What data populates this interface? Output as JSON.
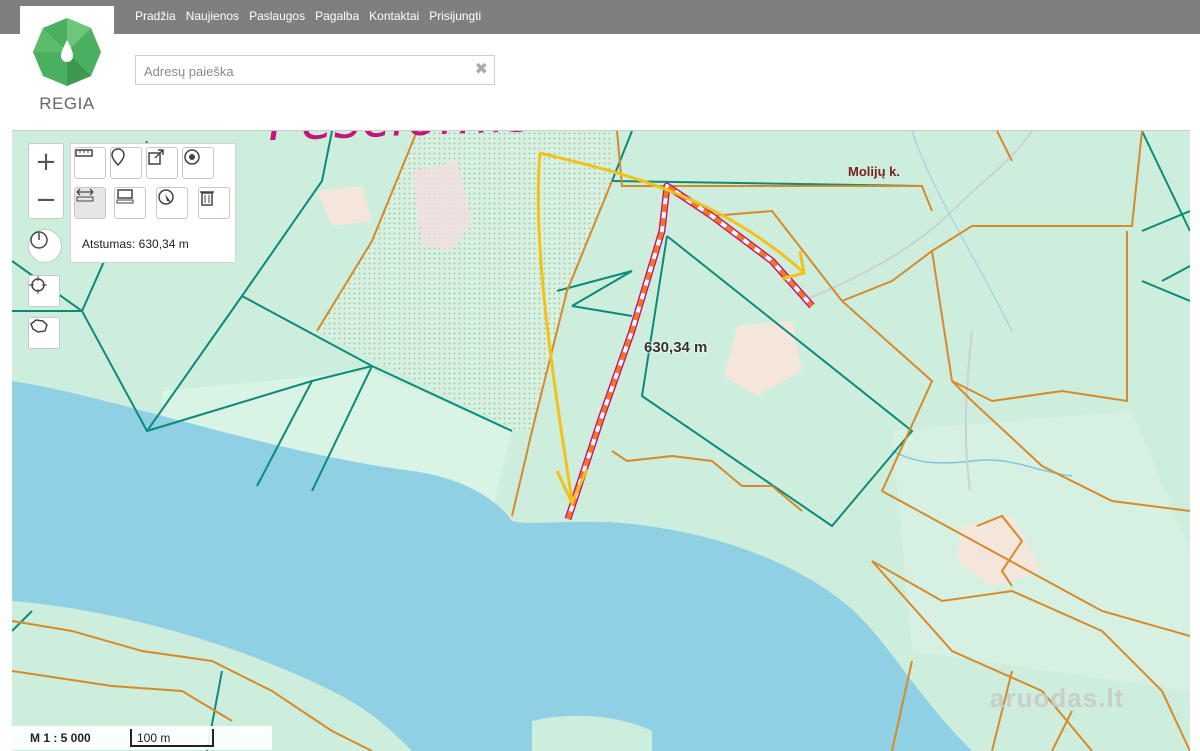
{
  "nav": {
    "items": [
      "Pradžia",
      "Naujienos",
      "Paslaugos",
      "Pagalba",
      "Kontaktai",
      "Prisijungti"
    ]
  },
  "logo": {
    "text": "REGIA"
  },
  "search": {
    "placeholder": "Adresų paieška",
    "value": ""
  },
  "tools": {
    "zoom_in": "+",
    "zoom_out": "−",
    "distance_label": "Atstumas: 630,34 m"
  },
  "map": {
    "village_label": "Molijų k.",
    "measure_label": "630,34 m",
    "scale_text": "M 1 : 5 000",
    "scale_bar_label": "100 m",
    "handwritten_note": "Pėsčiomis eiti čia",
    "watermark": "aruodas.lt",
    "colors": {
      "water": "#8fd0e4",
      "land": "#cdeedc",
      "parcel_teal": "#0e8a78",
      "parcel_orange": "#d68a2a",
      "route_magenta": "#c8137a",
      "arrow_yellow": "#f2c21b"
    }
  }
}
